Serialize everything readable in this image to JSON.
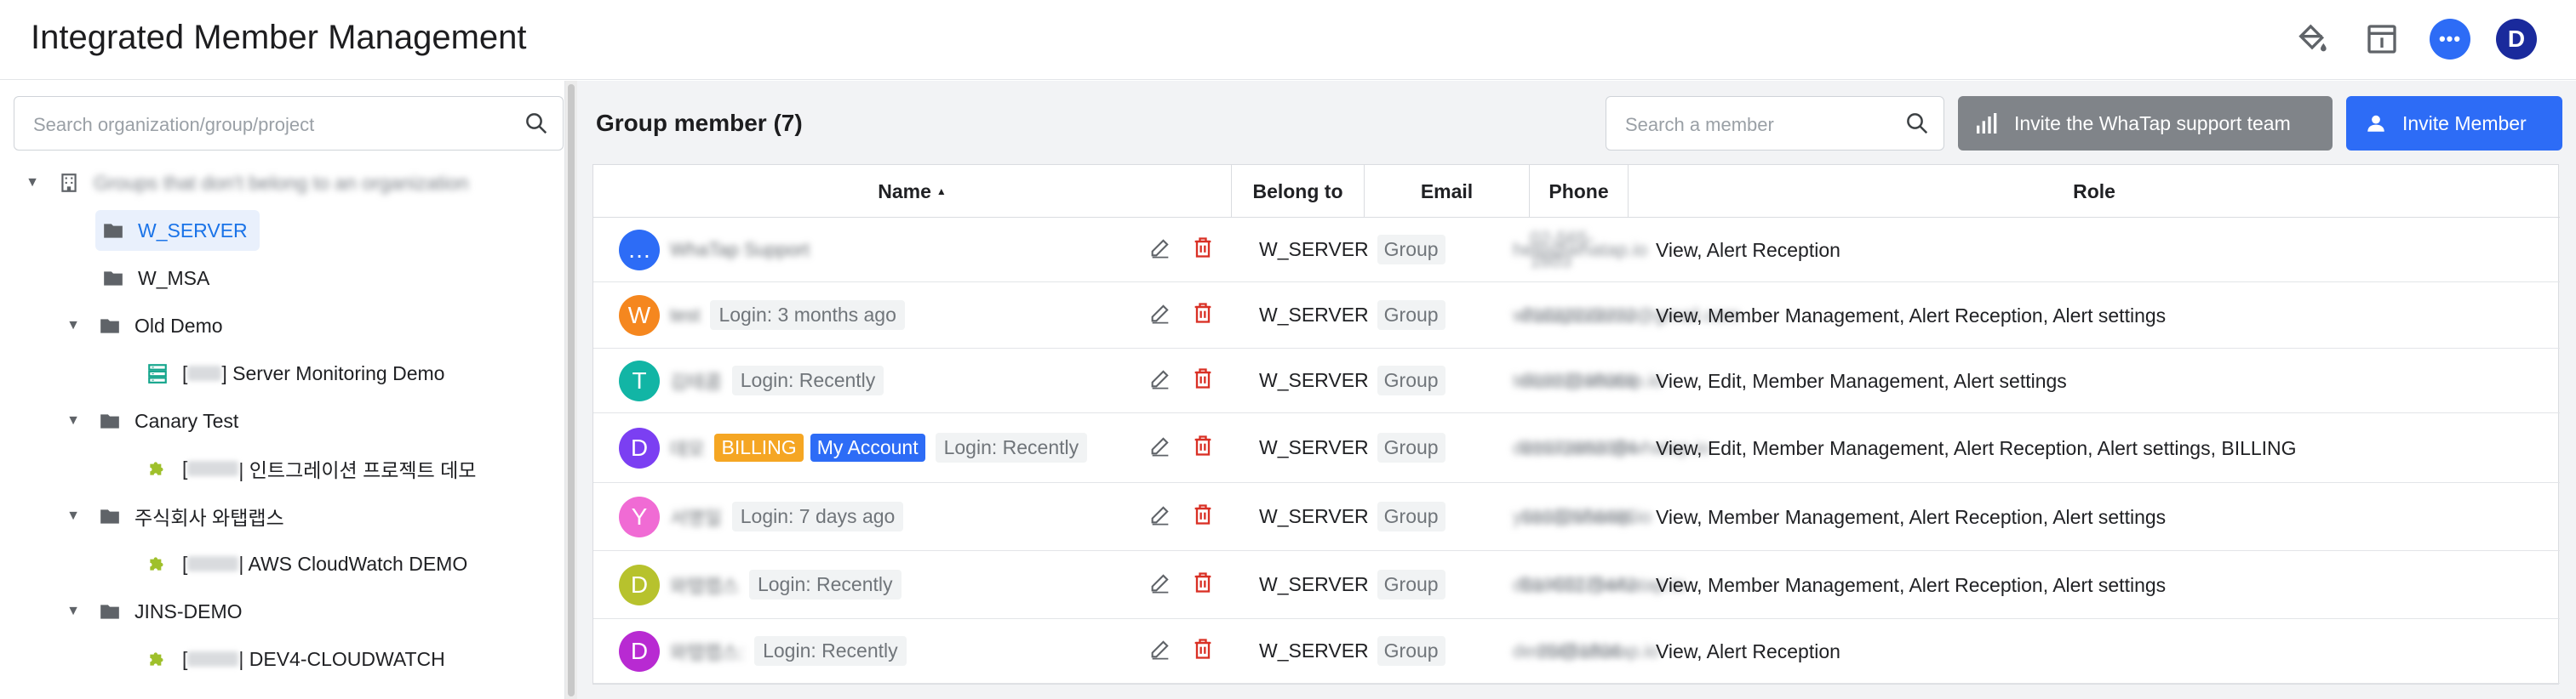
{
  "header": {
    "title": "Integrated Member Management",
    "icons": [
      "paint-bucket-icon",
      "info-panel-icon",
      "chat-icon"
    ],
    "user_initial": "D"
  },
  "sidebar": {
    "search_placeholder": "Search organization/group/project",
    "tree": [
      {
        "label": "Groups that don't belong to an organization",
        "blurred": true
      },
      {
        "label": "W_SERVER",
        "selected": true
      },
      {
        "label": "W_MSA"
      },
      {
        "label": "Old Demo"
      },
      {
        "prefix": "[",
        "label": "] Server Monitoring Demo"
      },
      {
        "label": "Canary Test"
      },
      {
        "prefix": "[",
        "label": "| 인트그레이션 프로젝트 데모"
      },
      {
        "label": "주식회사 와탭랩스"
      },
      {
        "prefix": "[",
        "label": "| AWS CloudWatch DEMO"
      },
      {
        "label": "JINS-DEMO"
      },
      {
        "prefix": "[",
        "label": "| DEV4-CLOUDWATCH"
      }
    ]
  },
  "main": {
    "title": "Group member (7)",
    "search_placeholder": "Search a member",
    "support_button": "Invite the WhaTap support team",
    "invite_button": "Invite Member",
    "columns": {
      "name": "Name",
      "belong": "Belong to",
      "email": "Email",
      "phone": "Phone",
      "role": "Role"
    },
    "sort_indicator": "▲",
    "members": [
      {
        "initial": "…",
        "color": "#2d6cf6",
        "name": "WhaTap Support",
        "login": "",
        "belong": "W_SERVER",
        "group": "Group",
        "email": "help@whatap.io",
        "phone": "02-565-1803",
        "role": "View, Alert Reception"
      },
      {
        "initial": "W",
        "color": "#f5871f",
        "name": "test",
        "login": "Login: 3 months ago",
        "belong": "W_SERVER",
        "group": "Group",
        "email": "whataptodemo@gmail.com",
        "phone": "01022222222",
        "role": "View, Member Management, Alert Reception, Alert settings"
      },
      {
        "initial": "T",
        "color": "#12b5a5",
        "name": "김테콤",
        "login": "Login: Recently",
        "belong": "W_SERVER",
        "group": "Group",
        "email": "tekom@whatap.io",
        "phone": "01023198069",
        "role": "View, Edit, Member Management, Alert settings"
      },
      {
        "initial": "D",
        "color": "#7b3ff2",
        "name": "데모",
        "billing": "BILLING",
        "account": "My Account",
        "login": "Login: Recently",
        "belong": "W_SERVER",
        "group": "Group",
        "email": "demoowner@whatap.io",
        "phone": "01072883384",
        "role": "View, Edit, Member Management, Alert Reception, Alert settings, BILLING"
      },
      {
        "initial": "Y",
        "color": "#f06bd4",
        "name": "서명일",
        "login": "Login: 7 days ago",
        "belong": "W_SERVER",
        "group": "Group",
        "email": "yseo@whatap.io",
        "phone": "01032556480",
        "role": "View, Member Management, Alert Reception, Alert settings"
      },
      {
        "initial": "D",
        "color": "#b7c22d",
        "name": "와탭랩스",
        "login": "Login: Recently",
        "belong": "W_SERVER",
        "group": "Group",
        "email": "dba+001@whatap.io",
        "phone": "01063275442",
        "role": "View, Member Management, Alert Reception, Alert settings"
      },
      {
        "initial": "D",
        "color": "#b82ad2",
        "name": "와탭랩스:",
        "login": "Login: Recently",
        "belong": "W_SERVER",
        "group": "Group",
        "email": "demo@whatap.io",
        "phone": "25651804",
        "role": "View, Alert Reception"
      }
    ]
  }
}
